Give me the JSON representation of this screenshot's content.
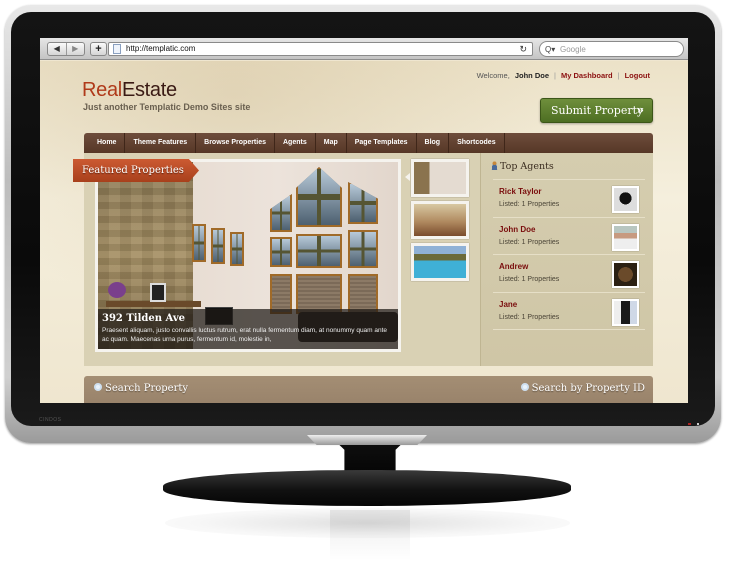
{
  "monitor": {
    "brand_label": "CINDOS"
  },
  "browser": {
    "back_icon": "◀",
    "forward_icon": "▶",
    "add_tab_icon": "+",
    "url": "http://templatic.com",
    "reload_icon": "↻",
    "search_icon": "Q▾",
    "search_placeholder": "Google"
  },
  "site": {
    "logo_part1": "Real",
    "logo_part2": "Estate",
    "tagline": "Just another Templatic Demo Sites site",
    "welcome_prefix": "Welcome,",
    "user_name": "John Doe",
    "separator": "|",
    "dashboard_link": "My Dashboard",
    "logout_link": "Logout",
    "submit_button": "Submit Property",
    "submit_arrows": "»"
  },
  "nav": {
    "items": [
      "Home",
      "Theme Features",
      "Browse Properties",
      "Agents",
      "Map",
      "Page Templates",
      "Blog",
      "Shortcodes"
    ]
  },
  "featured": {
    "ribbon": "Featured Properties",
    "title": "392 Tilden Ave",
    "description": "Praesent aliquam, justo convallis luctus rutrum, erat nulla fermentum diam, at nonummy quam ante ac quam. Maecenas urna purus, fermentum id, molestie in,",
    "thumbnails": [
      "living-room",
      "bedroom",
      "pool"
    ]
  },
  "agents": {
    "title": "Top Agents",
    "list": [
      {
        "name": "Rick Taylor",
        "count": "Listed: 1 Properties"
      },
      {
        "name": "John Doe",
        "count": "Listed: 1 Properties"
      },
      {
        "name": "Andrew",
        "count": "Listed: 1 Properties"
      },
      {
        "name": "Jane",
        "count": "Listed: 1 Properties"
      }
    ]
  },
  "search": {
    "left_title": "Search Property",
    "right_title": "Search by Property ID"
  },
  "colors": {
    "brand_red": "#b03a1a",
    "nav_brown": "#5f3f2e",
    "submit_green": "#5a7a2e",
    "agent_name_red": "#7a0d0d",
    "ribbon_orange": "#bb4d26"
  }
}
